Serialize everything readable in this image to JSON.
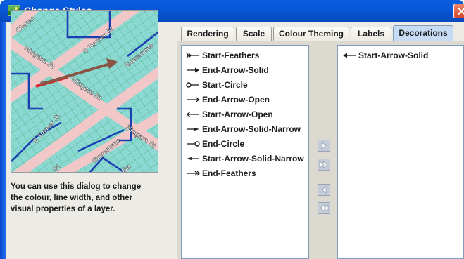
{
  "window": {
    "title": "Change Styles",
    "colors": {
      "titlebar": "#0856d6",
      "close": "#d5482c",
      "dialog_bg": "#ecebe5",
      "tab_active": "#c7dcf4"
    }
  },
  "preview": {
    "street_labels": [
      "Claren",
      "S Turner St",
      "Niagara St",
      "Governme",
      "Niagara St",
      "S Turner St",
      "Niagara St",
      "Governme",
      "St",
      "Ba"
    ],
    "help_text_lines": [
      "You can use this dialog to change",
      "the colour, line width, and other",
      "visual properties of a layer."
    ]
  },
  "tabs": [
    {
      "label": "Rendering",
      "active": false
    },
    {
      "label": "Scale",
      "active": false
    },
    {
      "label": "Colour Theming",
      "active": false
    },
    {
      "label": "Labels",
      "active": false
    },
    {
      "label": "Decorations",
      "active": true
    }
  ],
  "available_decorations": [
    {
      "label": "Start-Feathers",
      "icon": "start-feathers-icon"
    },
    {
      "label": "End-Arrow-Solid",
      "icon": "end-arrow-solid-icon"
    },
    {
      "label": "Start-Circle",
      "icon": "start-circle-icon"
    },
    {
      "label": "End-Arrow-Open",
      "icon": "end-arrow-open-icon"
    },
    {
      "label": "Start-Arrow-Open",
      "icon": "start-arrow-open-icon"
    },
    {
      "label": "End-Arrow-Solid-Narrow",
      "icon": "end-arrow-solid-narrow-icon"
    },
    {
      "label": "End-Circle",
      "icon": "end-circle-icon"
    },
    {
      "label": "Start-Arrow-Solid-Narrow",
      "icon": "start-arrow-solid-narrow-icon"
    },
    {
      "label": "End-Feathers",
      "icon": "end-feathers-icon"
    }
  ],
  "selected_decorations": [
    {
      "label": "Start-Arrow-Solid",
      "icon": "start-arrow-solid-icon"
    }
  ],
  "transfer_buttons": [
    {
      "name": "move-right-button",
      "icon": "single-right-arrow-icon"
    },
    {
      "name": "move-all-right-button",
      "icon": "double-right-arrow-icon"
    },
    {
      "name": "move-left-button",
      "icon": "single-left-arrow-icon"
    },
    {
      "name": "move-all-left-button",
      "icon": "double-left-arrow-icon"
    }
  ]
}
